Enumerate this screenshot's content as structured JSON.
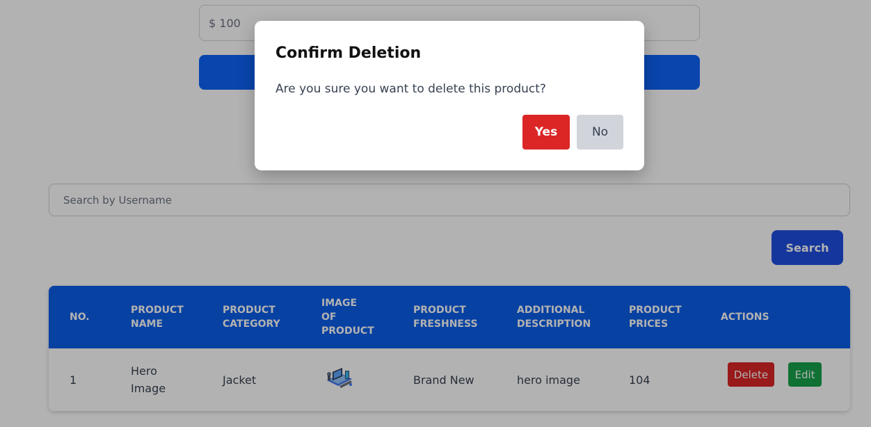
{
  "form": {
    "price_value": "$ 100",
    "submit_label": ""
  },
  "search": {
    "placeholder": "Search by Username",
    "button_label": "Search"
  },
  "table": {
    "headers": [
      "No.",
      "Product\nName",
      "Product\nCategory",
      "Image\nof\nProduct",
      "Product\nFreshness",
      "Additional\nDescription",
      "Product\nPrices",
      "Actions"
    ],
    "rows": [
      {
        "no": "1",
        "name": "Hero\nImage",
        "category": "Jacket",
        "image_icon": "laptop-illustration-icon",
        "freshness": "Brand New",
        "description": "hero image",
        "price": "104",
        "delete_label": "Delete",
        "edit_label": "Edit"
      }
    ]
  },
  "modal": {
    "title": "Confirm Deletion",
    "message": "Are you sure you want to delete this product?",
    "yes_label": "Yes",
    "no_label": "No"
  },
  "colors": {
    "primary": "#0d63f8",
    "table_header": "#0b5ee9",
    "search_button": "#1f4ee0",
    "danger": "#dc2626",
    "success": "#16a34a",
    "neutral_button": "#d1d5db"
  }
}
